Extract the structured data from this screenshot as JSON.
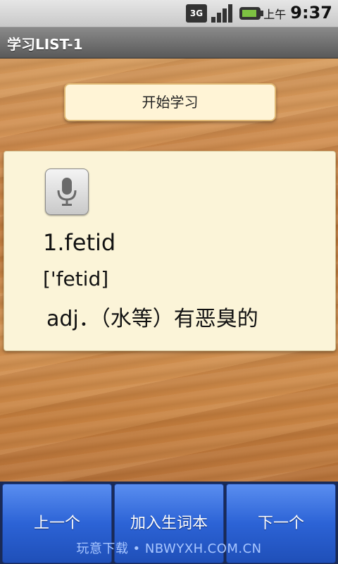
{
  "status_bar": {
    "network": "3G",
    "ampm": "上午",
    "time": "9:37"
  },
  "title_bar": {
    "title": "学习LIST-1"
  },
  "start_button": {
    "label": "开始学习"
  },
  "word_card": {
    "mic_icon": "microphone-icon",
    "word": "1.fetid",
    "phonetic": "['fetid]",
    "definition": "adj．（水等）有恶臭的"
  },
  "bottom_buttons": {
    "prev_label": "上一个",
    "add_label": "加入生词本",
    "next_label": "下一个"
  },
  "watermark": {
    "text": "玩意下载 • NBWYXH.COM.CN"
  },
  "colors": {
    "button_blue": "#2c63d6",
    "card_bg": "#fbf4d8",
    "wood": "#cf8c4e"
  }
}
